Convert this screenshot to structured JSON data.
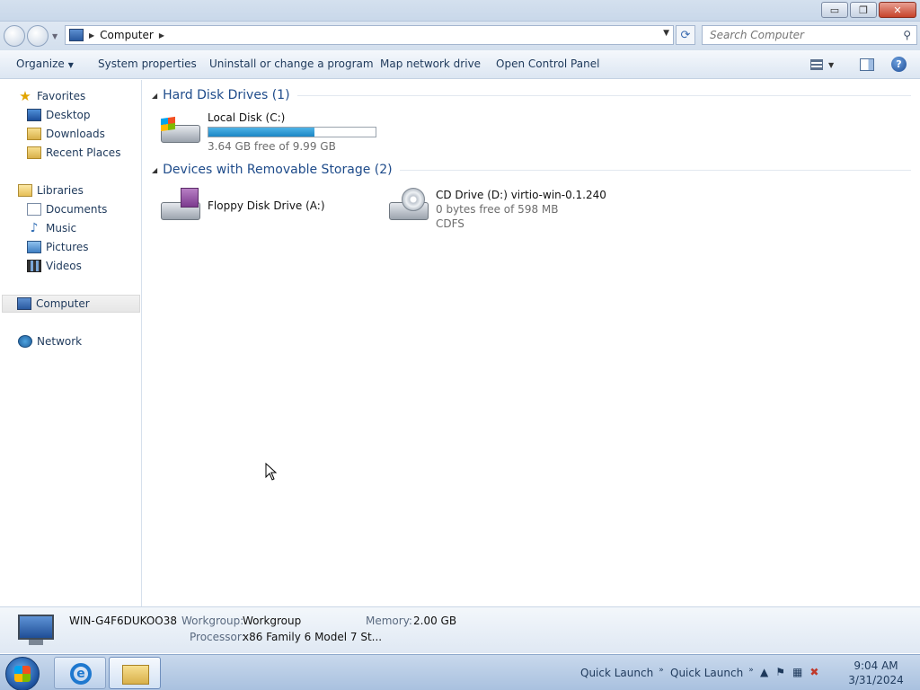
{
  "window": {
    "buttons": {
      "minimize": "▭",
      "maximize": "❐",
      "close": "✕"
    }
  },
  "address": {
    "path": "Computer",
    "search_placeholder": "Search Computer"
  },
  "commands": {
    "organize": "Organize",
    "system_properties": "System properties",
    "uninstall": "Uninstall or change a program",
    "map_drive": "Map network drive",
    "control_panel": "Open Control Panel"
  },
  "nav": {
    "favorites": "Favorites",
    "desktop": "Desktop",
    "downloads": "Downloads",
    "recent_places": "Recent Places",
    "libraries": "Libraries",
    "documents": "Documents",
    "music": "Music",
    "pictures": "Pictures",
    "videos": "Videos",
    "computer": "Computer",
    "network": "Network"
  },
  "content": {
    "hdd_group": "Hard Disk Drives (1)",
    "removable_group": "Devices with Removable Storage (2)",
    "local_disk": {
      "name": "Local Disk (C:)",
      "free_text": "3.64 GB free of 9.99 GB",
      "used_fraction": 0.636
    },
    "floppy": {
      "name": "Floppy Disk Drive (A:)"
    },
    "cd": {
      "name": "CD Drive (D:) virtio-win-0.1.240",
      "free_text": "0 bytes free of 598 MB",
      "fs": "CDFS"
    }
  },
  "details": {
    "computer_name": "WIN-G4F6DUKOO38",
    "workgroup_label": "Workgroup:",
    "workgroup_value": "Workgroup",
    "memory_label": "Memory:",
    "memory_value": "2.00 GB",
    "processor_label": "Processor:",
    "processor_value": "x86 Family 6 Model 7 St..."
  },
  "taskbar": {
    "quick_launch_1": "Quick Launch",
    "quick_launch_2": "Quick Launch",
    "time": "9:04 AM",
    "date": "3/31/2024"
  },
  "colors": {
    "accent": "#1e4b8a",
    "progress": "#2a9ad6"
  }
}
